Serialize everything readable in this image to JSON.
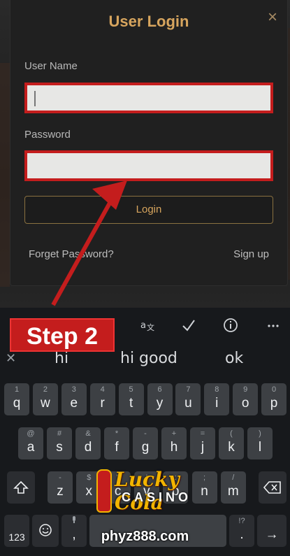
{
  "dialog": {
    "title": "User Login",
    "close_icon": "×",
    "username_label": "User Name",
    "username_value": "",
    "password_label": "Password",
    "password_value": "",
    "login_label": "Login",
    "forgot_label": "Forget Password?",
    "signup_label": "Sign up"
  },
  "annotation": {
    "step_label": "Step 2",
    "color": "#c41d1d"
  },
  "keyboard": {
    "toolbar_icons": [
      "translate-icon",
      "check-icon",
      "info-icon",
      "more-icon"
    ],
    "suggestions": [
      "hi",
      "hi good",
      "ok"
    ],
    "row1": [
      {
        "m": "q",
        "a": "1"
      },
      {
        "m": "w",
        "a": "2"
      },
      {
        "m": "e",
        "a": "3"
      },
      {
        "m": "r",
        "a": "4"
      },
      {
        "m": "t",
        "a": "5"
      },
      {
        "m": "y",
        "a": "6"
      },
      {
        "m": "u",
        "a": "7"
      },
      {
        "m": "i",
        "a": "8"
      },
      {
        "m": "o",
        "a": "9"
      },
      {
        "m": "p",
        "a": "0"
      }
    ],
    "row2": [
      {
        "m": "a",
        "a": "@"
      },
      {
        "m": "s",
        "a": "#"
      },
      {
        "m": "d",
        "a": "&"
      },
      {
        "m": "f",
        "a": "*"
      },
      {
        "m": "g",
        "a": "-"
      },
      {
        "m": "h",
        "a": "+"
      },
      {
        "m": "j",
        "a": "="
      },
      {
        "m": "k",
        "a": "("
      },
      {
        "m": "l",
        "a": ")"
      }
    ],
    "row3": [
      {
        "m": "z",
        "a": "-"
      },
      {
        "m": "x",
        "a": "$"
      },
      {
        "m": "c",
        "a": "\""
      },
      {
        "m": "v",
        "a": "'"
      },
      {
        "m": "b",
        "a": ":"
      },
      {
        "m": "n",
        "a": ";"
      },
      {
        "m": "m",
        "a": "/"
      }
    ],
    "numbers_label": "123",
    "punct_alt": "!?",
    "period_label": ",",
    "enter_icon": "→"
  },
  "watermark": {
    "title": "Lucky Cola",
    "subtitle": "CASINO",
    "site": "phyz888.com"
  }
}
